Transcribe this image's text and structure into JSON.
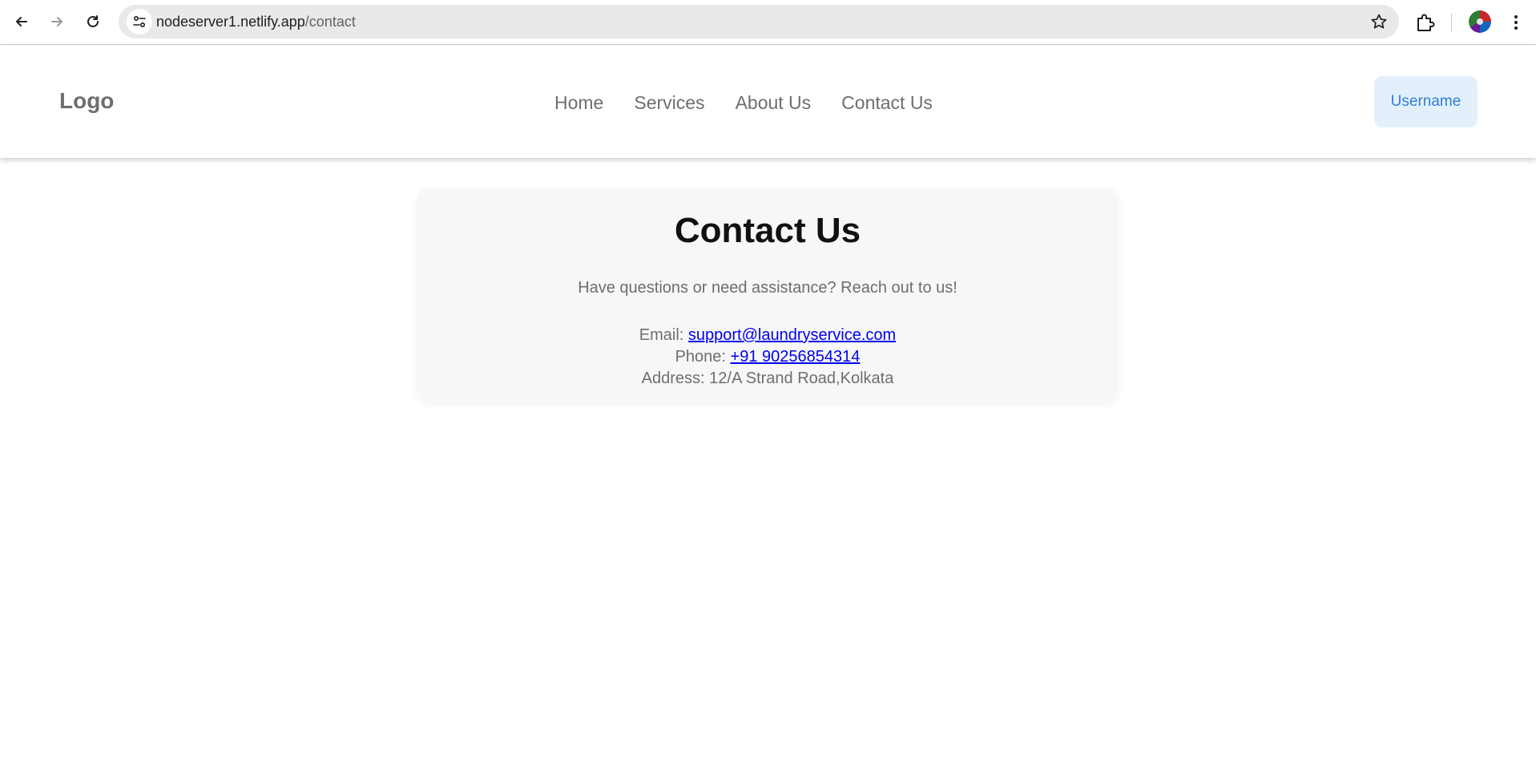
{
  "browser": {
    "url_host": "nodeserver1.netlify.app",
    "url_path": "/contact"
  },
  "header": {
    "logo": "Logo",
    "nav": [
      "Home",
      "Services",
      "About Us",
      "Contact Us"
    ],
    "user_button": "Username"
  },
  "contact": {
    "title": "Contact Us",
    "tagline": "Have questions or need assistance? Reach out to us!",
    "email_label": "Email: ",
    "email": "support@laundryservice.com",
    "phone_label": "Phone: ",
    "phone": "+91 90256854314",
    "address": "Address: 12/A Strand Road,Kolkata"
  },
  "colors": {
    "link": "#0000ee",
    "user_button_bg": "#e3f0fc",
    "user_button_text": "#2f7fd1",
    "card_bg": "#f7f7f7"
  },
  "icons": [
    "back-arrow-icon",
    "forward-arrow-icon",
    "reload-icon",
    "site-info-icon",
    "bookmark-star-icon",
    "extensions-puzzle-icon",
    "profile-avatar-icon",
    "more-menu-icon"
  ]
}
